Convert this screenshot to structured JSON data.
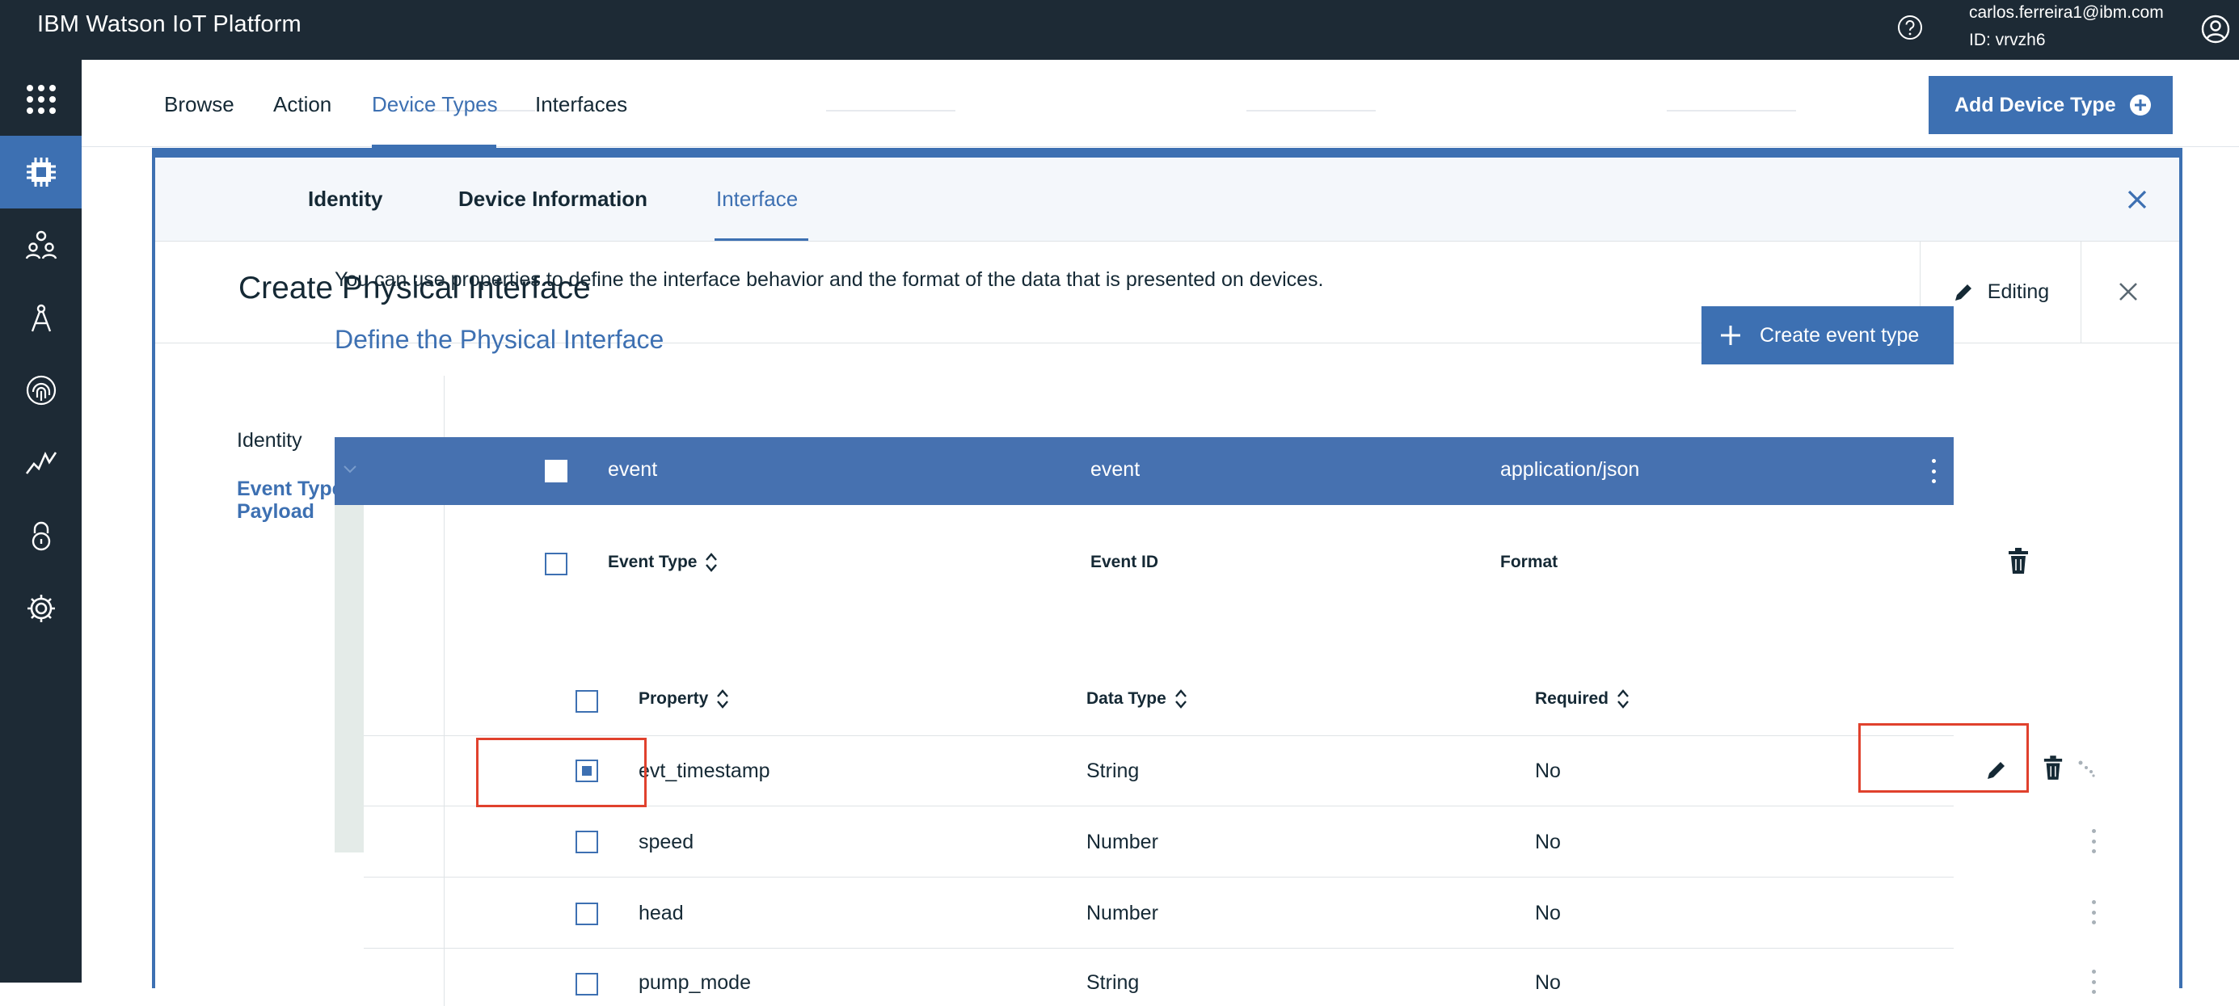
{
  "app": {
    "title": "IBM Watson IoT Platform",
    "user_email": "carlos.ferreira1@ibm.com",
    "user_id": "ID: vrvzh6"
  },
  "icons": {
    "help": "help-circle-icon",
    "account": "user-avatar-icon",
    "rail": [
      "app-grid-icon",
      "device-chip-icon",
      "members-icon",
      "rules-compass-icon",
      "security-fingerprint-icon",
      "usage-chart-icon",
      "lock-icon",
      "settings-gear-icon"
    ]
  },
  "colors": {
    "topbar": "#1d2a35",
    "accent": "#3d70b2",
    "selected_row": "#4671b0",
    "highlight_box": "#e0412d"
  },
  "nav": {
    "tabs": [
      "Browse",
      "Action",
      "Device Types",
      "Interfaces"
    ],
    "active": "Device Types",
    "add_button": "Add Device Type"
  },
  "wizard": {
    "tabs": [
      "Identity",
      "Device Information",
      "Interface"
    ],
    "active": "Interface"
  },
  "header": {
    "title": "Create Physical Interface",
    "editing_label": "Editing"
  },
  "side_nav": {
    "items": [
      "Identity",
      "Event Types and Payload"
    ],
    "active": "Event Types and Payload"
  },
  "content": {
    "intro": "You can use properties to define the interface behavior and the format of the data that is presented on devices.",
    "section_title": "Define the Physical Interface",
    "create_event_button": "Create event type"
  },
  "event_table": {
    "headers": [
      "Event Type",
      "Event ID",
      "Format"
    ],
    "rows": [
      {
        "event_type": "event",
        "event_id": "event",
        "format": "application/json"
      }
    ]
  },
  "property_table": {
    "headers": [
      "Property",
      "Data Type",
      "Required"
    ],
    "rows": [
      {
        "property": "evt_timestamp",
        "data_type": "String",
        "required": "No",
        "checked": true
      },
      {
        "property": "speed",
        "data_type": "Number",
        "required": "No",
        "checked": false
      },
      {
        "property": "head",
        "data_type": "Number",
        "required": "No",
        "checked": false
      },
      {
        "property": "pump_mode",
        "data_type": "String",
        "required": "No",
        "checked": false
      }
    ]
  }
}
